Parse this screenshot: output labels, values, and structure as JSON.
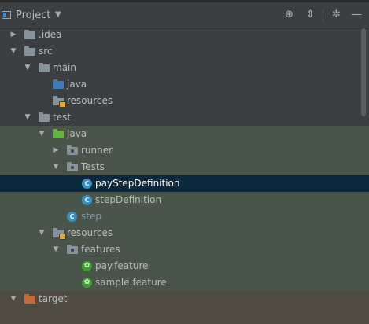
{
  "header": {
    "title": "Project",
    "icons": [
      "project-view-icon",
      "dropdown-caret-icon",
      "locate-icon",
      "collapse-all-icon",
      "gear-icon",
      "hide-icon"
    ],
    "locate_glyph": "⊕",
    "collapse_glyph": "⇕",
    "gear_glyph": "✲",
    "hide_glyph": "—",
    "caret_glyph": "▼"
  },
  "tree": {
    "collapsed_glyph": "▶",
    "expanded_glyph": "▼",
    "items": [
      {
        "label": ".idea",
        "icon": "folder"
      },
      {
        "label": "src",
        "icon": "folder"
      },
      {
        "label": "main",
        "icon": "folder"
      },
      {
        "label": "java",
        "icon": "source-folder"
      },
      {
        "label": "resources",
        "icon": "resources-folder"
      },
      {
        "label": "test",
        "icon": "folder"
      },
      {
        "label": "java",
        "icon": "test-source-folder"
      },
      {
        "label": "runner",
        "icon": "package"
      },
      {
        "label": "Tests",
        "icon": "package"
      },
      {
        "label": "payStepDefinition",
        "icon": "class",
        "selected": true
      },
      {
        "label": "stepDefinition",
        "icon": "class"
      },
      {
        "label": "step",
        "icon": "class"
      },
      {
        "label": "resources",
        "icon": "test-resources-folder"
      },
      {
        "label": "features",
        "icon": "package"
      },
      {
        "label": "pay.feature",
        "icon": "cucumber"
      },
      {
        "label": "sample.feature",
        "icon": "cucumber"
      },
      {
        "label": "target",
        "icon": "excluded-folder"
      }
    ],
    "class_glyph": "C",
    "cucumber_glyph": "✿"
  },
  "colors": {
    "panel_bg": "#3c3f41",
    "test_region_bg": "#49544a",
    "selection_bg": "#0d293e",
    "target_region_bg": "#4f4b41",
    "source_folder": "#3d7db5",
    "test_folder": "#62b543",
    "excluded_folder": "#c26b3c",
    "class_icon": "#3a8fbf",
    "cucumber_icon": "#3d9f2f"
  }
}
